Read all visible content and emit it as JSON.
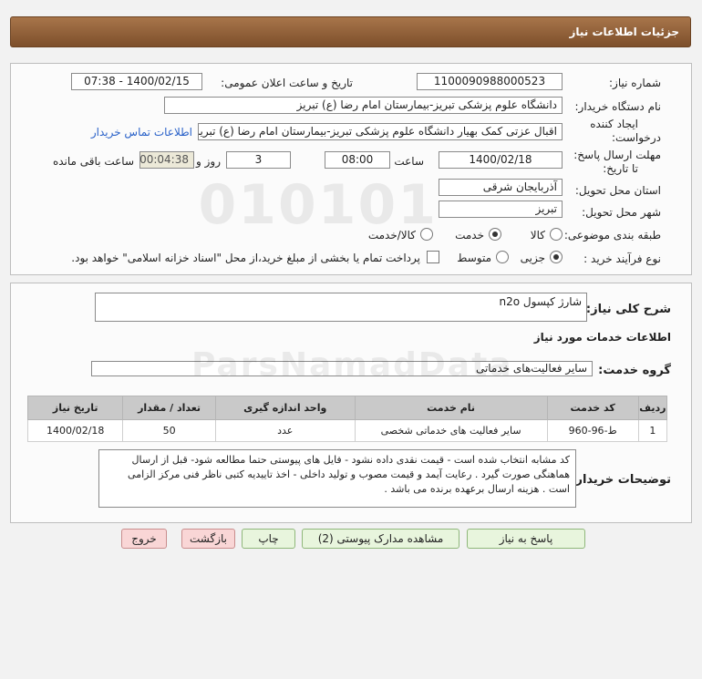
{
  "header": {
    "title": "جزئیات اطلاعات نیاز"
  },
  "form": {
    "need_number_label": "شماره نیاز:",
    "need_number": "1100090988000523",
    "announce_label": "تاریخ و ساعت اعلان عمومی:",
    "announce_value": "1400/02/15 - 07:38",
    "buyer_org_label": "نام دستگاه خریدار:",
    "buyer_org": "دانشگاه علوم پزشکی تبریز-بیمارستان امام رضا (ع) تبریز",
    "creator_label_1": "ایجاد کننده",
    "creator_label_2": "درخواست:",
    "creator": "اقبال عزتی کمک بهیار دانشگاه علوم پزشکی تبریز-بیمارستان امام رضا (ع) تبریز",
    "contact_link": "اطلاعات تماس خریدار",
    "deadline_label_1": "مهلت ارسال پاسخ:",
    "deadline_label_2": "تا تاریخ:",
    "deadline_date": "1400/02/18",
    "time_label": "ساعت",
    "deadline_time": "08:00",
    "days_value": "3",
    "days_label": "روز و",
    "remaining_time": "00:04:38",
    "remaining_label": "ساعت باقی مانده",
    "province_label": "استان محل تحویل:",
    "province": "آذربایجان شرقی",
    "city_label": "شهر محل تحویل:",
    "city": "تبریز",
    "category_label": "طبقه بندی موضوعی:",
    "category_options": [
      "کالا",
      "خدمت",
      "کالا/خدمت"
    ],
    "category_selected": "خدمت",
    "process_label": "نوع فرآیند خرید :",
    "process_options": [
      "جزیی",
      "متوسط"
    ],
    "process_selected": "جزیی",
    "payment_note": "پرداخت تمام یا بخشی از مبلغ خرید،از محل \"اسناد خزانه اسلامی\" خواهد بود."
  },
  "summary": {
    "label": "شرح کلی نیاز:",
    "value": "شارژ کپسول n2o"
  },
  "services": {
    "section_title": "اطلاعات خدمات مورد نیاز",
    "group_label": "گروه خدمت:",
    "group_value": "سایر فعالیت‌های خدماتی",
    "columns": [
      "ردیف",
      "کد خدمت",
      "نام خدمت",
      "واحد اندازه گیری",
      "تعداد / مقدار",
      "تاریخ نیاز"
    ],
    "rows": [
      [
        "1",
        "ط-96-960",
        "سایر فعالیت های خدماتی شخصی",
        "عدد",
        "50",
        "1400/02/18"
      ]
    ]
  },
  "buyer_notes": {
    "label": "توضیحات خریدار:",
    "text": "کد مشابه انتخاب شده است - قیمت نقدی داده نشود - فایل های پیوستی حتما مطالعه شود- قبل از ارسال هماهنگی صورت گیرد . رعایت آیمد و قیمت مصوب و تولید داخلی -  اخذ تاییدیه کتبی ناظر فنی مرکز الزامی است . هزینه ارسال برعهده برنده می باشد ."
  },
  "watermark": {
    "digits": "010101",
    "text": "ParsNamadData"
  },
  "buttons": {
    "reply": "پاسخ به نیاز",
    "attachments": "مشاهده مدارک پیوستی (2)",
    "print": "چاپ",
    "back": "بازگشت",
    "exit": "خروج"
  },
  "colors": {
    "title_bar": "#8b5a33",
    "link": "#2a62c9",
    "table_header": "#c9c9c9"
  }
}
